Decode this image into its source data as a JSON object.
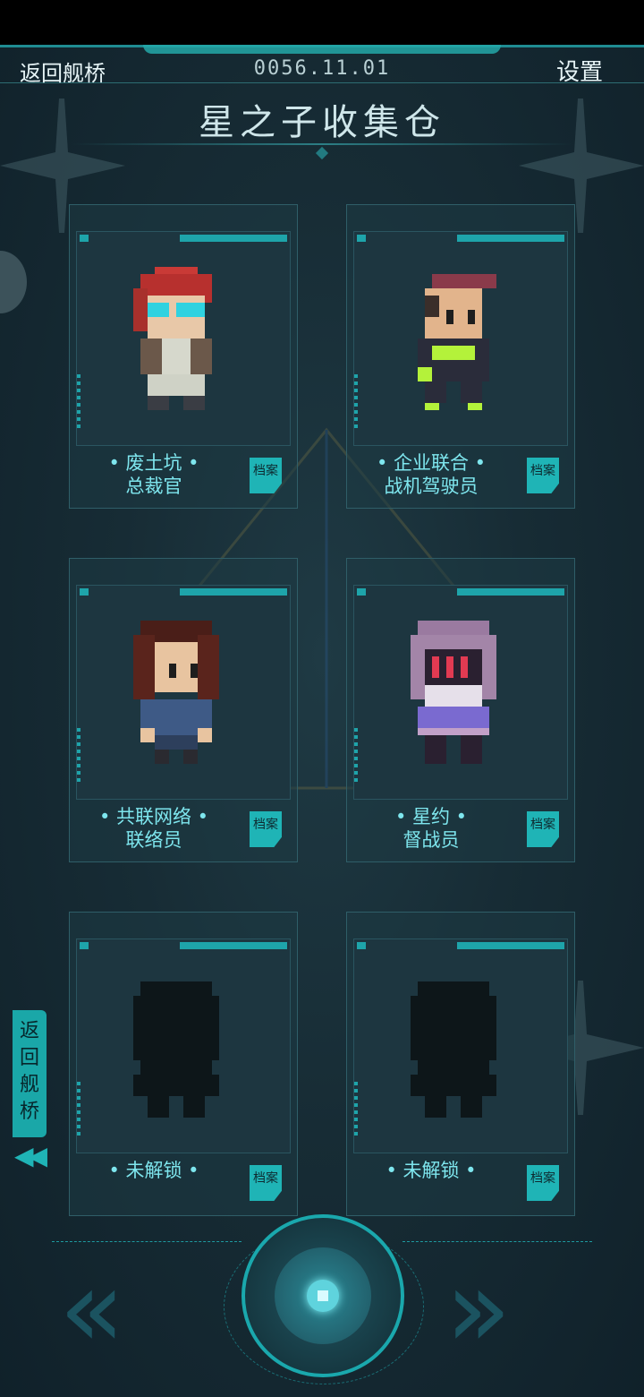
{
  "header": {
    "back_label": "返回舰桥",
    "date": "0056.11.01",
    "settings_label": "设置",
    "title": "星之子收集仓"
  },
  "cards": [
    {
      "name_line1": "• 废土坑 •",
      "name_line2": "总裁官",
      "file_label": "档案",
      "unlocked": true
    },
    {
      "name_line1": "• 企业联合 •",
      "name_line2": "战机驾驶员",
      "file_label": "档案",
      "unlocked": true
    },
    {
      "name_line1": "• 共联网络 •",
      "name_line2": "联络员",
      "file_label": "档案",
      "unlocked": true
    },
    {
      "name_line1": "• 星约 •",
      "name_line2": "督战员",
      "file_label": "档案",
      "unlocked": true
    },
    {
      "name_line1": "• 未解锁 •",
      "name_line2": "",
      "file_label": "档案",
      "unlocked": false
    },
    {
      "name_line1": "• 未解锁 •",
      "name_line2": "",
      "file_label": "档案",
      "unlocked": false
    }
  ],
  "side_back": {
    "chars": [
      "返",
      "回",
      "舰",
      "桥"
    ],
    "arrows": "◀◀"
  },
  "nav": {
    "prev": "«",
    "next": "»"
  },
  "colors": {
    "accent": "#1fb4b6",
    "name_text": "#7ee6ee",
    "panel": "#172c35"
  }
}
